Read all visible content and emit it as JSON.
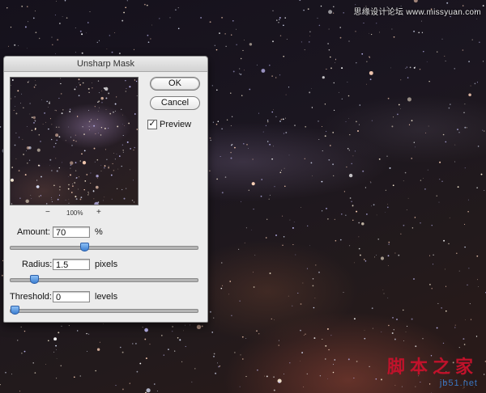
{
  "watermark": {
    "top": "思缘设计论坛 www.missyuan.com",
    "bottom_cn": "脚本之家",
    "bottom_url": "jb51.net"
  },
  "dialog": {
    "title": "Unsharp Mask",
    "ok_label": "OK",
    "cancel_label": "Cancel",
    "preview_label": "Preview",
    "preview_checked": true,
    "zoom_out": "−",
    "zoom_level": "100%",
    "zoom_in": "+",
    "amount": {
      "label": "Amount:",
      "value": "70",
      "unit": "%",
      "slider_fraction": 0.39
    },
    "radius": {
      "label": "Radius:",
      "value": "1.5",
      "unit": "pixels",
      "slider_fraction": 0.11
    },
    "threshold": {
      "label": "Threshold:",
      "value": "0",
      "unit": "levels",
      "slider_fraction": 0.0
    }
  },
  "colors": {
    "slider_thumb": "#3d7fd1",
    "dialog_bg": "#ececec",
    "watermark_red": "#c0122b",
    "watermark_blue": "#3a78c2"
  }
}
